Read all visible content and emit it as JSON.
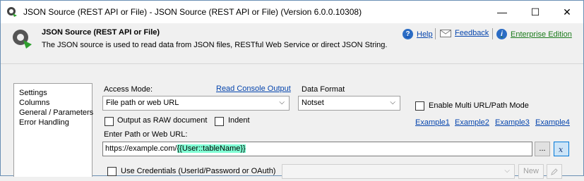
{
  "window": {
    "title": "JSON Source (REST API or File) - JSON Source (REST API or File) (Version 6.0.0.10308)",
    "controls": {
      "minimize": "—",
      "maximize": "☐",
      "close": "✕"
    }
  },
  "header": {
    "title": "JSON Source (REST API or File)",
    "description": "The JSON source is used to read data from JSON files, RESTful Web Service or direct JSON String.",
    "help_label": "Help",
    "feedback_label": "Feedback",
    "enterprise_label": "Enterprise Edition"
  },
  "nav": {
    "items": [
      "Settings",
      "Columns",
      "General / Parameters",
      "Error Handling"
    ]
  },
  "settings": {
    "access_mode_label": "Access Mode:",
    "read_console_label": "Read Console Output",
    "access_mode_value": "File path or web URL",
    "data_format_label": "Data Format",
    "data_format_value": "Notset",
    "multi_url_label": "Enable Multi URL/Path Mode",
    "output_raw_label": "Output as RAW document",
    "indent_label": "Indent",
    "examples": [
      "Example1",
      "Example2",
      "Example3",
      "Example4"
    ],
    "path_label": "Enter Path or Web URL:",
    "path_value_prefix": "https://example.com/",
    "path_value_var": "{{User::tableName}}",
    "browse_label": "...",
    "use_credentials_label": "Use Credentials (UserId/Password or OAuth)",
    "new_label": "New"
  },
  "colors": {
    "link": "#0645ad",
    "enterprise": "#1a7a1a",
    "highlight": "#7fffd4",
    "title_bar": "#ffffff",
    "background": "#f0f0f0"
  }
}
